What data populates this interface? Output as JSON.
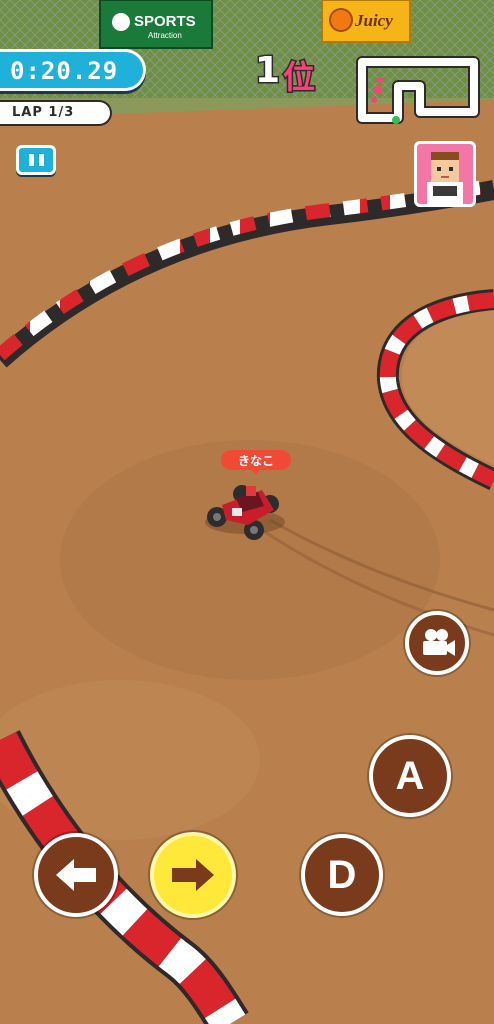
{
  "hud": {
    "timer": "0:20.29",
    "lap": "LAP 1/3",
    "position_number": "1",
    "position_suffix": "位",
    "player_name": "きなこ"
  },
  "billboards": {
    "sports_title": "SPORTS",
    "sports_sub": "Attraction",
    "juicy": "Juicy"
  },
  "controls": {
    "a_label": "A",
    "d_label": "D"
  },
  "colors": {
    "track_dirt": "#b9804e",
    "curb_red": "#d8262c",
    "curb_white": "#ffffff",
    "hud_blue": "#1fb1d9",
    "rank_pink": "#ff3f7c",
    "button_brown": "#7a3a1c",
    "button_yellow": "#ffe83a"
  },
  "icons": [
    "pause-icon",
    "camera-icon",
    "arrow-left-icon",
    "arrow-right-icon",
    "track-minimap-icon",
    "driver-avatar-icon"
  ]
}
